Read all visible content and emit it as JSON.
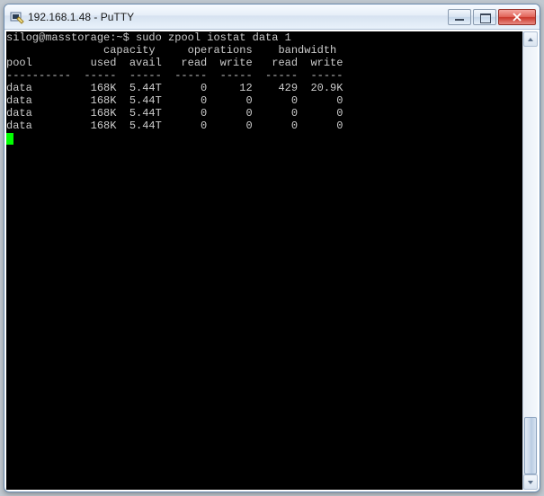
{
  "window": {
    "title": "192.168.1.48 - PuTTY"
  },
  "prompt": {
    "text": "silog@masstorage:~$ ",
    "command": "sudo zpool iostat data 1"
  },
  "header": {
    "group_line": "               capacity     operations    bandwidth",
    "cols_line": "pool         used  avail   read  write   read  write",
    "sep_line": "----------  -----  -----  -----  -----  -----  -----"
  },
  "rows": [
    {
      "pool": "data",
      "used": "168K",
      "avail": "5.44T",
      "rops": "0",
      "wops": "12",
      "rbw": "429",
      "wbw": "20.9K"
    },
    {
      "pool": "data",
      "used": "168K",
      "avail": "5.44T",
      "rops": "0",
      "wops": "0",
      "rbw": "0",
      "wbw": "0"
    },
    {
      "pool": "data",
      "used": "168K",
      "avail": "5.44T",
      "rops": "0",
      "wops": "0",
      "rbw": "0",
      "wbw": "0"
    },
    {
      "pool": "data",
      "used": "168K",
      "avail": "5.44T",
      "rops": "0",
      "wops": "0",
      "rbw": "0",
      "wbw": "0"
    }
  ]
}
